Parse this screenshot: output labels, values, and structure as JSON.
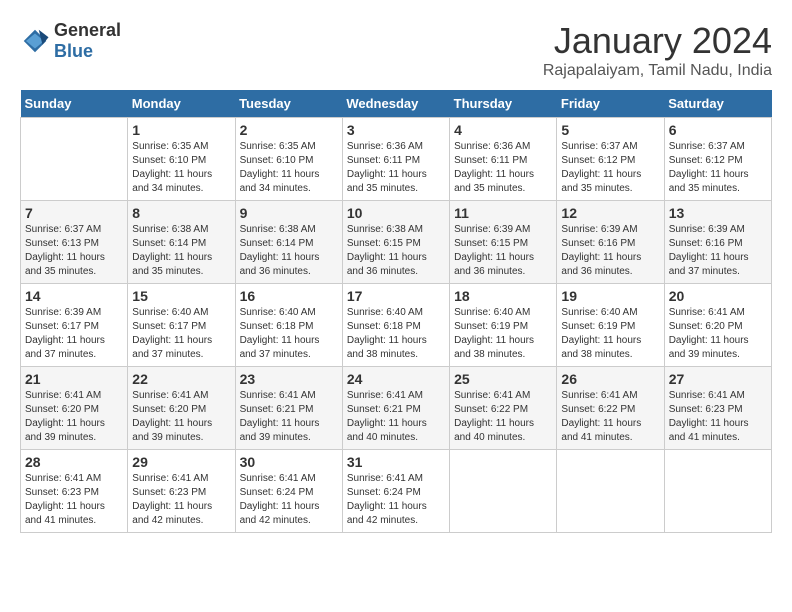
{
  "header": {
    "logo": {
      "general": "General",
      "blue": "Blue"
    },
    "title": "January 2024",
    "subtitle": "Rajapalaiyam, Tamil Nadu, India"
  },
  "days_of_week": [
    "Sunday",
    "Monday",
    "Tuesday",
    "Wednesday",
    "Thursday",
    "Friday",
    "Saturday"
  ],
  "weeks": [
    [
      {
        "day": "",
        "sunrise": "",
        "sunset": "",
        "daylight": ""
      },
      {
        "day": "1",
        "sunrise": "Sunrise: 6:35 AM",
        "sunset": "Sunset: 6:10 PM",
        "daylight": "Daylight: 11 hours and 34 minutes."
      },
      {
        "day": "2",
        "sunrise": "Sunrise: 6:35 AM",
        "sunset": "Sunset: 6:10 PM",
        "daylight": "Daylight: 11 hours and 34 minutes."
      },
      {
        "day": "3",
        "sunrise": "Sunrise: 6:36 AM",
        "sunset": "Sunset: 6:11 PM",
        "daylight": "Daylight: 11 hours and 35 minutes."
      },
      {
        "day": "4",
        "sunrise": "Sunrise: 6:36 AM",
        "sunset": "Sunset: 6:11 PM",
        "daylight": "Daylight: 11 hours and 35 minutes."
      },
      {
        "day": "5",
        "sunrise": "Sunrise: 6:37 AM",
        "sunset": "Sunset: 6:12 PM",
        "daylight": "Daylight: 11 hours and 35 minutes."
      },
      {
        "day": "6",
        "sunrise": "Sunrise: 6:37 AM",
        "sunset": "Sunset: 6:12 PM",
        "daylight": "Daylight: 11 hours and 35 minutes."
      }
    ],
    [
      {
        "day": "7",
        "sunrise": "Sunrise: 6:37 AM",
        "sunset": "Sunset: 6:13 PM",
        "daylight": "Daylight: 11 hours and 35 minutes."
      },
      {
        "day": "8",
        "sunrise": "Sunrise: 6:38 AM",
        "sunset": "Sunset: 6:14 PM",
        "daylight": "Daylight: 11 hours and 35 minutes."
      },
      {
        "day": "9",
        "sunrise": "Sunrise: 6:38 AM",
        "sunset": "Sunset: 6:14 PM",
        "daylight": "Daylight: 11 hours and 36 minutes."
      },
      {
        "day": "10",
        "sunrise": "Sunrise: 6:38 AM",
        "sunset": "Sunset: 6:15 PM",
        "daylight": "Daylight: 11 hours and 36 minutes."
      },
      {
        "day": "11",
        "sunrise": "Sunrise: 6:39 AM",
        "sunset": "Sunset: 6:15 PM",
        "daylight": "Daylight: 11 hours and 36 minutes."
      },
      {
        "day": "12",
        "sunrise": "Sunrise: 6:39 AM",
        "sunset": "Sunset: 6:16 PM",
        "daylight": "Daylight: 11 hours and 36 minutes."
      },
      {
        "day": "13",
        "sunrise": "Sunrise: 6:39 AM",
        "sunset": "Sunset: 6:16 PM",
        "daylight": "Daylight: 11 hours and 37 minutes."
      }
    ],
    [
      {
        "day": "14",
        "sunrise": "Sunrise: 6:39 AM",
        "sunset": "Sunset: 6:17 PM",
        "daylight": "Daylight: 11 hours and 37 minutes."
      },
      {
        "day": "15",
        "sunrise": "Sunrise: 6:40 AM",
        "sunset": "Sunset: 6:17 PM",
        "daylight": "Daylight: 11 hours and 37 minutes."
      },
      {
        "day": "16",
        "sunrise": "Sunrise: 6:40 AM",
        "sunset": "Sunset: 6:18 PM",
        "daylight": "Daylight: 11 hours and 37 minutes."
      },
      {
        "day": "17",
        "sunrise": "Sunrise: 6:40 AM",
        "sunset": "Sunset: 6:18 PM",
        "daylight": "Daylight: 11 hours and 38 minutes."
      },
      {
        "day": "18",
        "sunrise": "Sunrise: 6:40 AM",
        "sunset": "Sunset: 6:19 PM",
        "daylight": "Daylight: 11 hours and 38 minutes."
      },
      {
        "day": "19",
        "sunrise": "Sunrise: 6:40 AM",
        "sunset": "Sunset: 6:19 PM",
        "daylight": "Daylight: 11 hours and 38 minutes."
      },
      {
        "day": "20",
        "sunrise": "Sunrise: 6:41 AM",
        "sunset": "Sunset: 6:20 PM",
        "daylight": "Daylight: 11 hours and 39 minutes."
      }
    ],
    [
      {
        "day": "21",
        "sunrise": "Sunrise: 6:41 AM",
        "sunset": "Sunset: 6:20 PM",
        "daylight": "Daylight: 11 hours and 39 minutes."
      },
      {
        "day": "22",
        "sunrise": "Sunrise: 6:41 AM",
        "sunset": "Sunset: 6:20 PM",
        "daylight": "Daylight: 11 hours and 39 minutes."
      },
      {
        "day": "23",
        "sunrise": "Sunrise: 6:41 AM",
        "sunset": "Sunset: 6:21 PM",
        "daylight": "Daylight: 11 hours and 39 minutes."
      },
      {
        "day": "24",
        "sunrise": "Sunrise: 6:41 AM",
        "sunset": "Sunset: 6:21 PM",
        "daylight": "Daylight: 11 hours and 40 minutes."
      },
      {
        "day": "25",
        "sunrise": "Sunrise: 6:41 AM",
        "sunset": "Sunset: 6:22 PM",
        "daylight": "Daylight: 11 hours and 40 minutes."
      },
      {
        "day": "26",
        "sunrise": "Sunrise: 6:41 AM",
        "sunset": "Sunset: 6:22 PM",
        "daylight": "Daylight: 11 hours and 41 minutes."
      },
      {
        "day": "27",
        "sunrise": "Sunrise: 6:41 AM",
        "sunset": "Sunset: 6:23 PM",
        "daylight": "Daylight: 11 hours and 41 minutes."
      }
    ],
    [
      {
        "day": "28",
        "sunrise": "Sunrise: 6:41 AM",
        "sunset": "Sunset: 6:23 PM",
        "daylight": "Daylight: 11 hours and 41 minutes."
      },
      {
        "day": "29",
        "sunrise": "Sunrise: 6:41 AM",
        "sunset": "Sunset: 6:23 PM",
        "daylight": "Daylight: 11 hours and 42 minutes."
      },
      {
        "day": "30",
        "sunrise": "Sunrise: 6:41 AM",
        "sunset": "Sunset: 6:24 PM",
        "daylight": "Daylight: 11 hours and 42 minutes."
      },
      {
        "day": "31",
        "sunrise": "Sunrise: 6:41 AM",
        "sunset": "Sunset: 6:24 PM",
        "daylight": "Daylight: 11 hours and 42 minutes."
      },
      {
        "day": "",
        "sunrise": "",
        "sunset": "",
        "daylight": ""
      },
      {
        "day": "",
        "sunrise": "",
        "sunset": "",
        "daylight": ""
      },
      {
        "day": "",
        "sunrise": "",
        "sunset": "",
        "daylight": ""
      }
    ]
  ]
}
